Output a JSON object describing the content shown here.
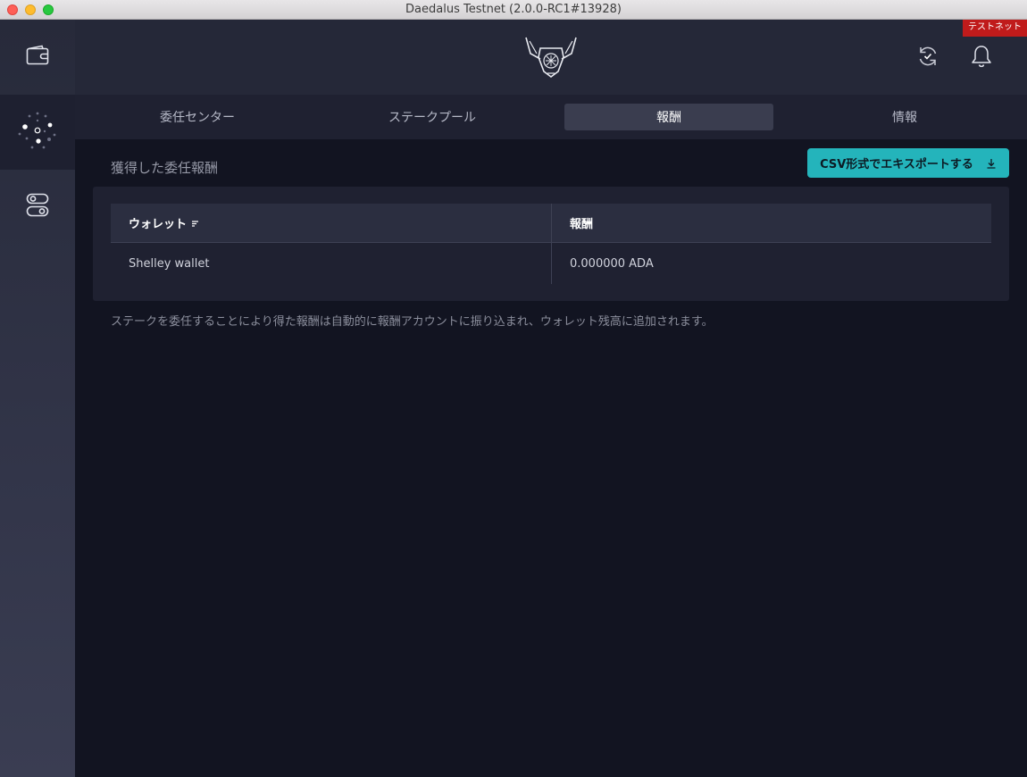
{
  "window": {
    "title": "Daedalus Testnet (2.0.0-RC1#13928)"
  },
  "header": {
    "testnet_badge": "テストネット"
  },
  "sidebar": {
    "items": [
      {
        "name": "wallets",
        "icon": "wallet-icon",
        "active": false
      },
      {
        "name": "staking",
        "icon": "staking-icon",
        "active": true
      },
      {
        "name": "settings",
        "icon": "settings-toggle-icon",
        "active": false
      }
    ]
  },
  "tabs": [
    {
      "label": "委任センター",
      "active": false
    },
    {
      "label": "ステークプール",
      "active": false
    },
    {
      "label": "報酬",
      "active": true
    },
    {
      "label": "情報",
      "active": false
    }
  ],
  "rewards": {
    "title": "獲得した委任報酬",
    "export_label": "CSV形式でエキスポートする",
    "columns": [
      "ウォレット",
      "報酬"
    ],
    "rows": [
      {
        "wallet": "Shelley wallet",
        "reward": "0.000000 ADA"
      }
    ],
    "note": "ステークを委任することにより得た報酬は自動的に報酬アカウントに振り込まれ、ウォレット残高に追加されます。"
  },
  "colors": {
    "accent": "#24b4bb",
    "badge": "#c01b1b",
    "background": "#121421"
  }
}
